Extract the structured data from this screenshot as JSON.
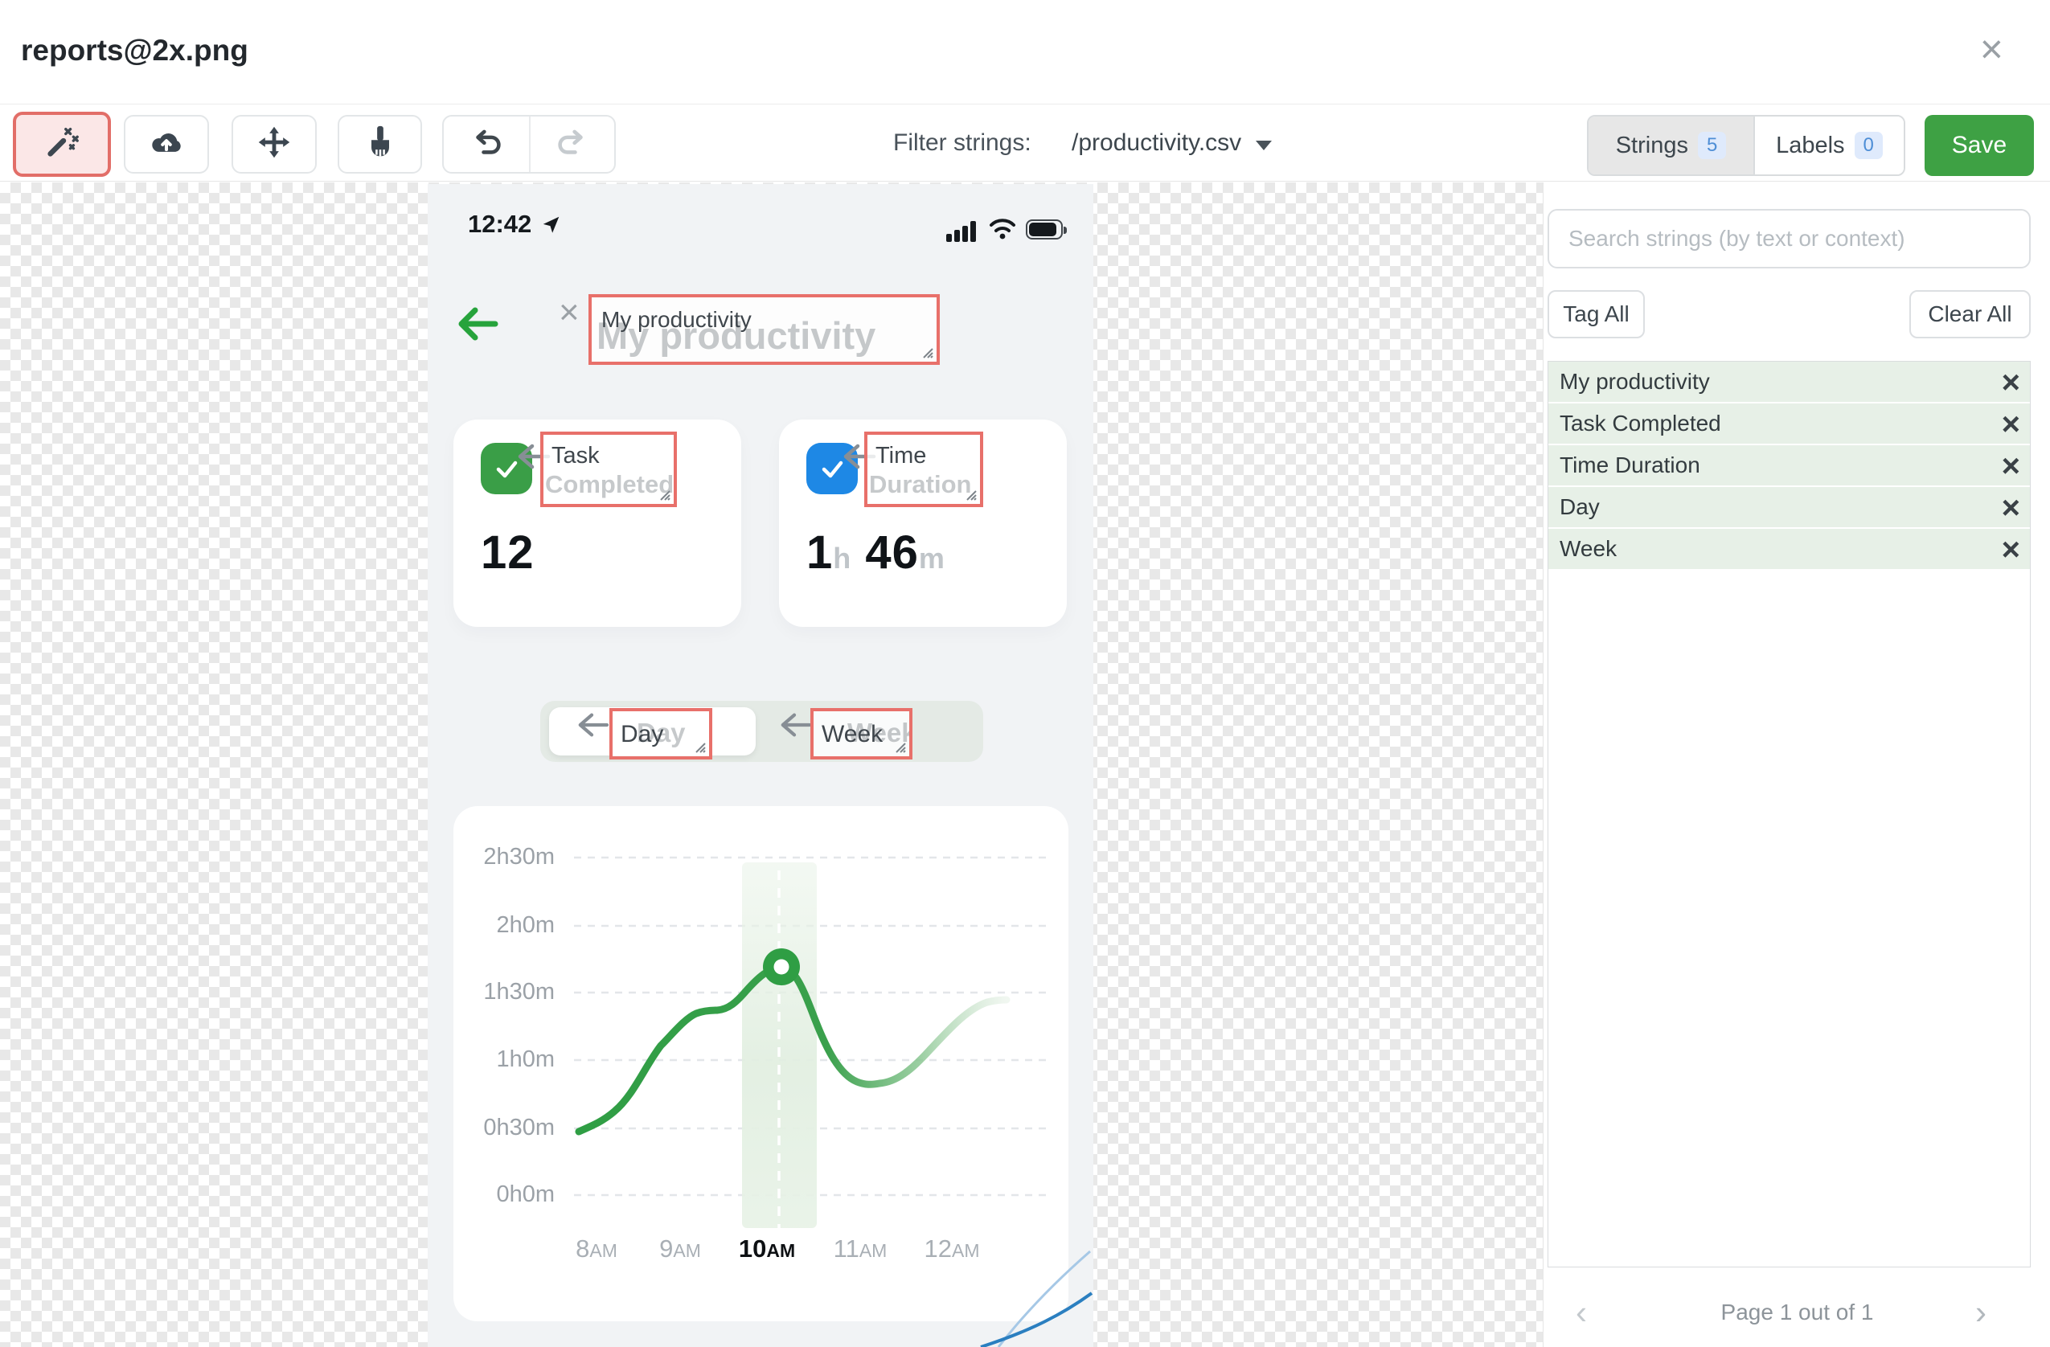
{
  "header": {
    "title": "reports@2x.png"
  },
  "toolbar": {
    "filter_label": "Filter strings:",
    "filter_value": "/productivity.csv",
    "strings_tab": "Strings",
    "strings_count": "5",
    "labels_tab": "Labels",
    "labels_count": "0",
    "save_label": "Save"
  },
  "phone": {
    "status_time": "12:42",
    "title_tag": {
      "text": "My productivity",
      "ghost": "My productivity"
    },
    "task_card": {
      "line1": "Task",
      "line2": "Completed",
      "ghost": "Completed",
      "value": "12"
    },
    "time_card": {
      "line1": "Time",
      "line2": "Duration",
      "ghost": "Duration",
      "hours": "1",
      "hours_unit": "h",
      "minutes": "46",
      "minutes_unit": "m"
    },
    "toggle": {
      "day": "Day",
      "day_ghost": "Day",
      "week": "Week",
      "week_ghost": "Week"
    }
  },
  "chart_data": {
    "type": "line",
    "title": "",
    "x": [
      "8AM",
      "9AM",
      "10AM",
      "11AM",
      "12AM"
    ],
    "xticks": [
      {
        "num": "8",
        "suffix": "AM"
      },
      {
        "num": "9",
        "suffix": "AM"
      },
      {
        "num": "10",
        "suffix": "AM"
      },
      {
        "num": "11",
        "suffix": "AM"
      },
      {
        "num": "12",
        "suffix": "AM"
      }
    ],
    "yticks": [
      "2h30m",
      "2h0m",
      "1h30m",
      "1h0m",
      "0h30m",
      "0h0m"
    ],
    "values_minutes": [
      28,
      80,
      101,
      50,
      87
    ],
    "values_labels": [
      "0h28m",
      "1h20m",
      "1h41m",
      "0h50m",
      "1h27m"
    ],
    "highlighted_x": "10AM",
    "ylim_minutes": [
      0,
      150
    ],
    "grid": "dashed horizontal",
    "line_color": "#2f9e44"
  },
  "sidebar": {
    "search_placeholder": "Search strings (by text or context)",
    "tag_all": "Tag All",
    "clear_all": "Clear All",
    "strings": [
      "My productivity",
      "Task Completed",
      "Time Duration",
      "Day",
      "Week"
    ],
    "pagination": "Page 1 out of 1"
  },
  "colors": {
    "save_green": "#3ea144",
    "tag_border_red": "#e8706a",
    "tool_active_bg": "#fbe7e7",
    "task_icon_green": "#3a9e47",
    "time_icon_blue": "#1e88e5",
    "back_arrow_green": "#27a33c",
    "row_green": "#e7f0e7",
    "badge_blue": "#4e8ed6",
    "chart_line_green": "#2f9e44"
  }
}
